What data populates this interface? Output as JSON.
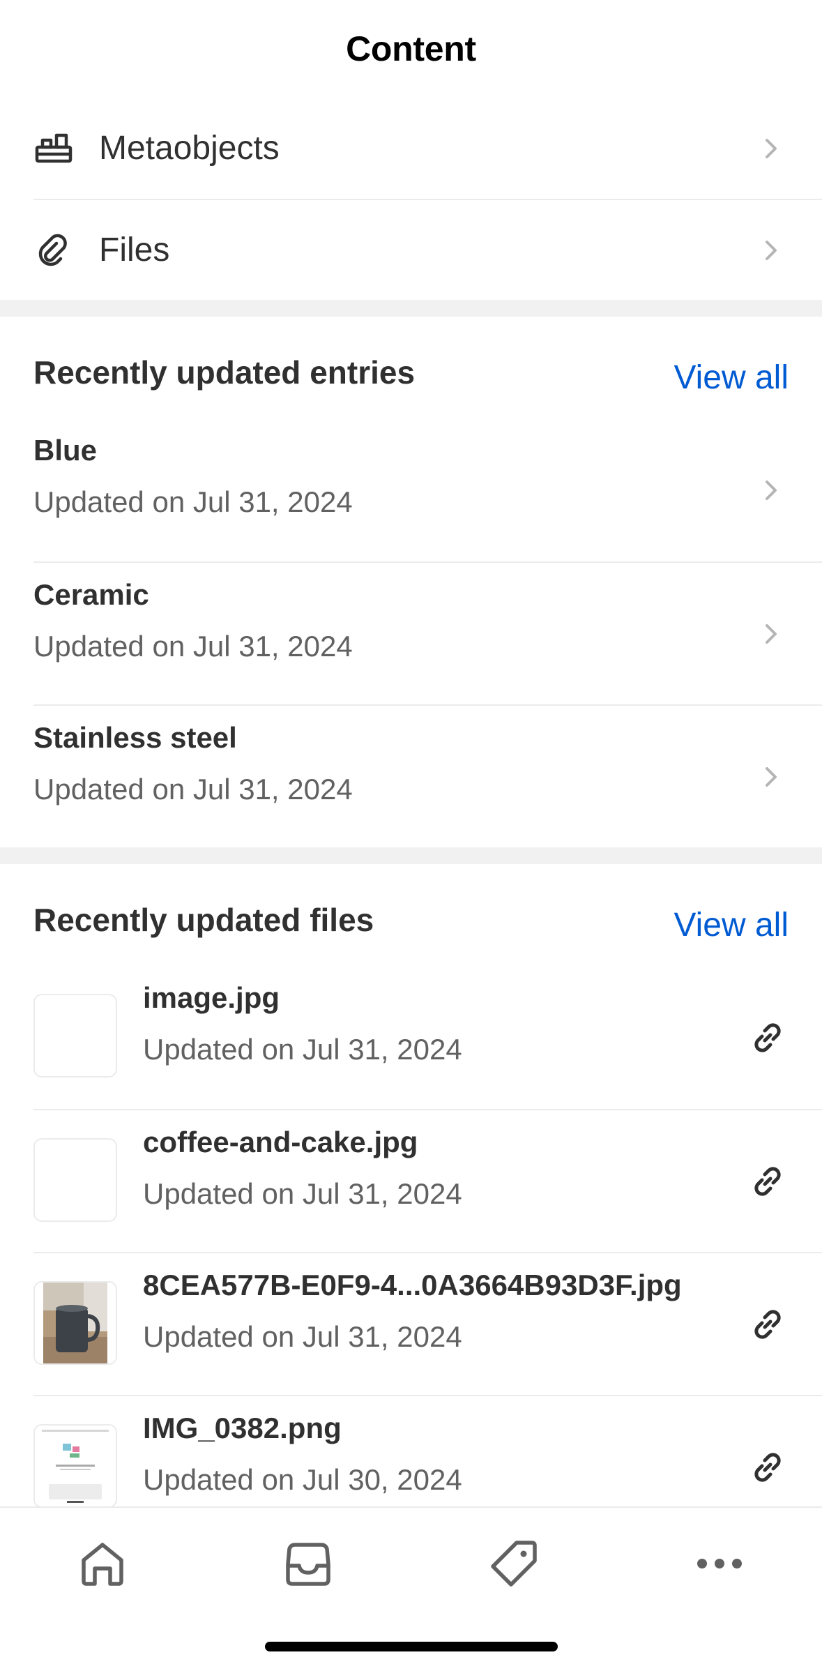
{
  "header": {
    "title": "Content"
  },
  "nav": [
    {
      "label": "Metaobjects",
      "icon": "metaobjects-icon"
    },
    {
      "label": "Files",
      "icon": "paperclip-icon"
    }
  ],
  "entries": {
    "title": "Recently updated entries",
    "view_all": "View all",
    "items": [
      {
        "title": "Blue",
        "updated": "Updated on Jul 31, 2024"
      },
      {
        "title": "Ceramic",
        "updated": "Updated on Jul 31, 2024"
      },
      {
        "title": "Stainless steel",
        "updated": "Updated on Jul 31, 2024"
      }
    ]
  },
  "files": {
    "title": "Recently updated files",
    "view_all": "View all",
    "items": [
      {
        "name": "image.jpg",
        "updated": "Updated on Jul 31, 2024",
        "thumb": "blank"
      },
      {
        "name": "coffee-and-cake.jpg",
        "updated": "Updated on Jul 31, 2024",
        "thumb": "blank"
      },
      {
        "name": "8CEA577B-E0F9-4...0A3664B93D3F.jpg",
        "updated": "Updated on Jul 31, 2024",
        "thumb": "mug-photo"
      },
      {
        "name": "IMG_0382.png",
        "updated": "Updated on Jul 30, 2024",
        "thumb": "screenshot"
      }
    ]
  },
  "tabbar": {
    "tabs": [
      {
        "icon": "home-icon"
      },
      {
        "icon": "inbox-icon"
      },
      {
        "icon": "tag-icon"
      },
      {
        "icon": "more-icon"
      }
    ]
  },
  "colors": {
    "link": "#005bd3",
    "text": "#303030",
    "subtext": "#616161",
    "divider": "#ebebeb",
    "gap": "#f1f1f1"
  }
}
